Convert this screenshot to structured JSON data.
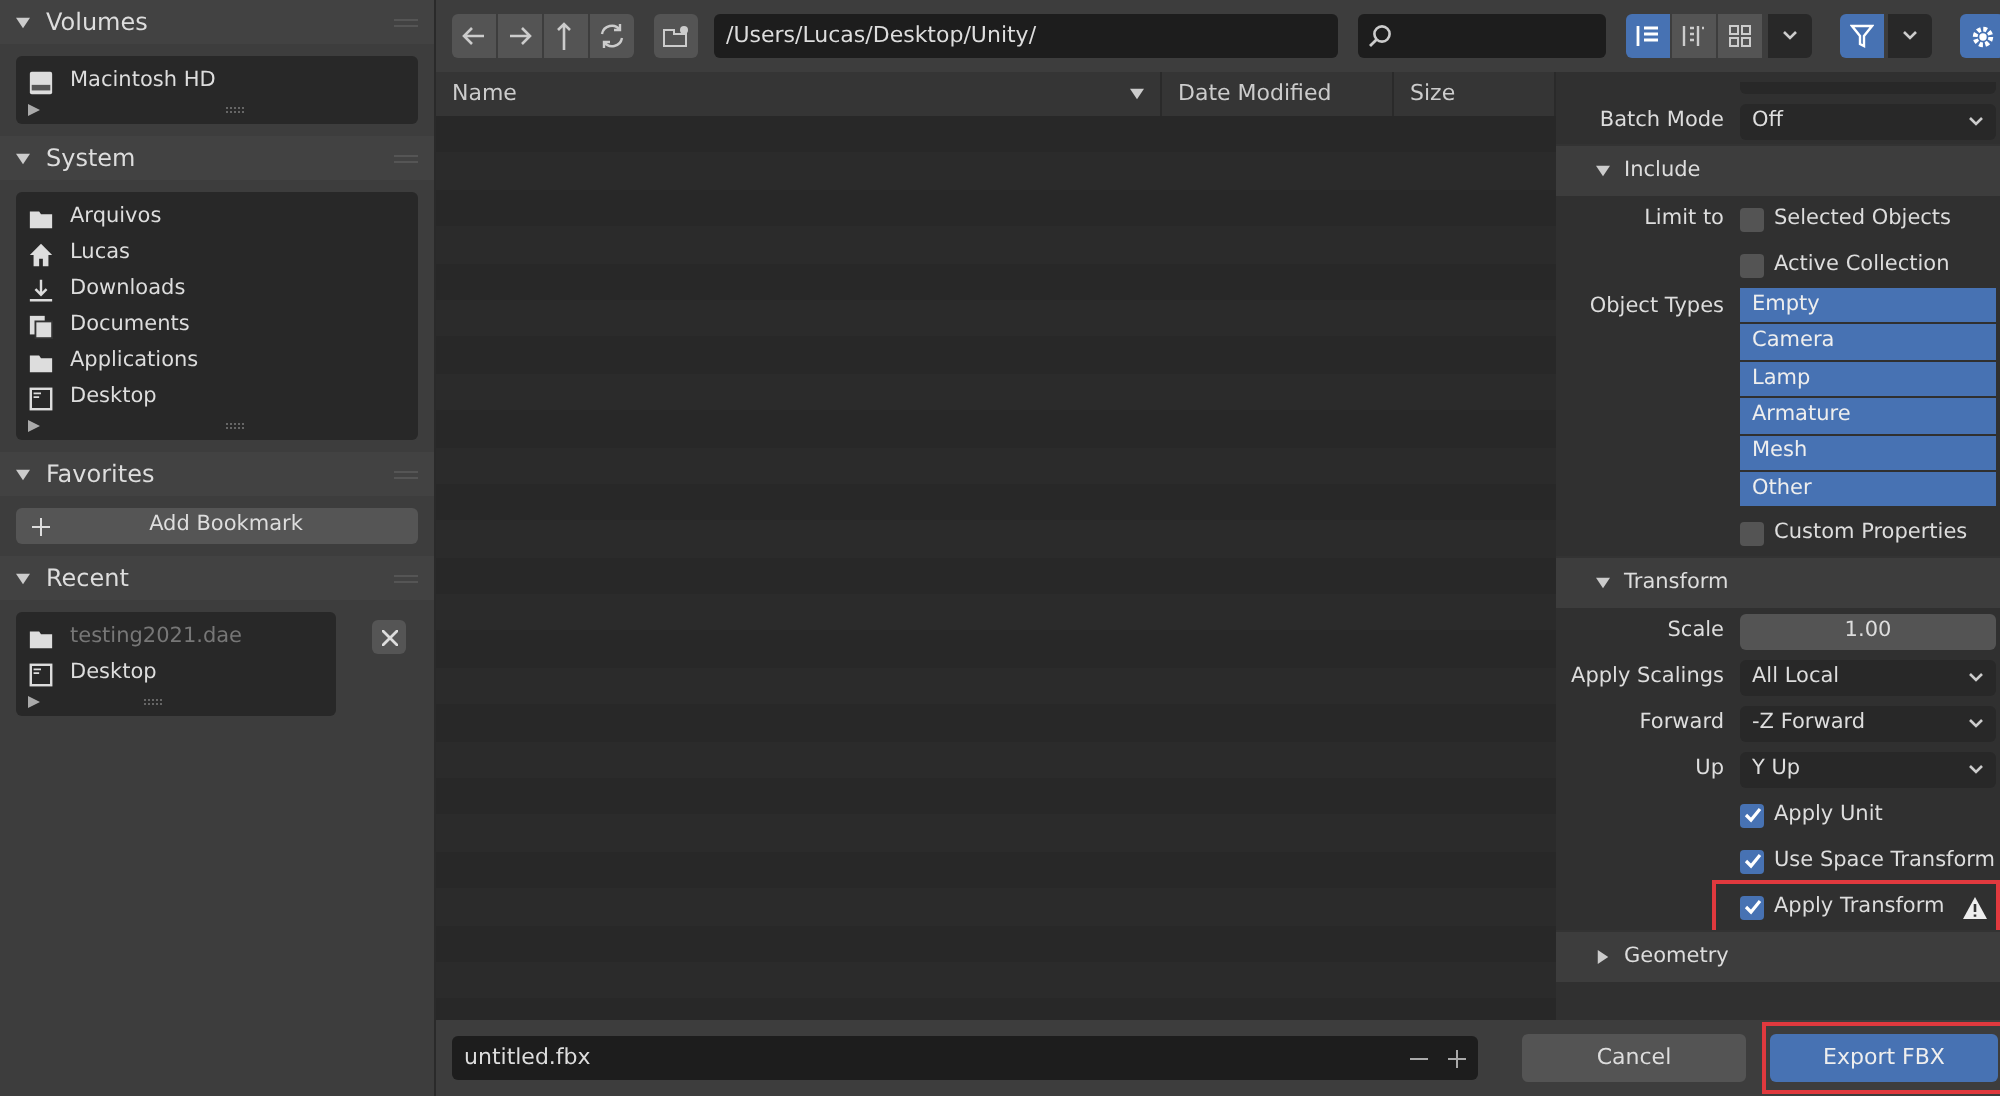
{
  "sidebar": [
    {
      "title": "Volumes",
      "expanded": true,
      "items": [
        {
          "kind": "drive",
          "label": "Macintosh HD",
          "dimmed": false
        }
      ]
    },
    {
      "title": "System",
      "expanded": true,
      "items": [
        {
          "kind": "folder",
          "label": "Arquivos",
          "dimmed": false
        },
        {
          "kind": "home",
          "label": "Lucas",
          "dimmed": false
        },
        {
          "kind": "download",
          "label": "Downloads",
          "dimmed": false
        },
        {
          "kind": "documents",
          "label": "Documents",
          "dimmed": false
        },
        {
          "kind": "folder",
          "label": "Applications",
          "dimmed": false
        },
        {
          "kind": "desktop",
          "label": "Desktop",
          "dimmed": false
        }
      ]
    },
    {
      "title": "Favorites",
      "expanded": true,
      "button": "Add Bookmark"
    },
    {
      "title": "Recent",
      "expanded": true,
      "removable": true,
      "items": [
        {
          "kind": "folder",
          "label": "testing2021.dae",
          "dimmed": true
        },
        {
          "kind": "desktop",
          "label": "Desktop",
          "dimmed": false
        }
      ]
    }
  ],
  "toolbar": {
    "path": "/Users/Lucas/Desktop/Unity/",
    "view_modes": [
      {
        "kind": "list",
        "selected": true
      },
      {
        "kind": "columns",
        "selected": false
      },
      {
        "kind": "grid",
        "selected": false
      }
    ],
    "filter_on": true,
    "settings_on": true
  },
  "columns": [
    {
      "label": "Name",
      "sorted": true
    },
    {
      "label": "Date Modified",
      "sorted": false
    },
    {
      "label": "Size",
      "sorted": false
    }
  ],
  "settings": [
    {
      "kind": "dropdown",
      "label": "Batch Mode",
      "value": "Off"
    },
    {
      "kind": "section",
      "label": "Include",
      "expanded": true
    },
    {
      "kind": "checkbox",
      "label": "Limit to",
      "text": "Selected Objects",
      "checked": false
    },
    {
      "kind": "checkbox",
      "text": "Active Collection",
      "checked": false
    },
    {
      "kind": "toggles",
      "label": "Object Types",
      "options": [
        {
          "text": "Empty",
          "selected": true
        },
        {
          "text": "Camera",
          "selected": true
        },
        {
          "text": "Lamp",
          "selected": true
        },
        {
          "text": "Armature",
          "selected": true
        },
        {
          "text": "Mesh",
          "selected": true
        },
        {
          "text": "Other",
          "selected": true
        }
      ]
    },
    {
      "kind": "checkbox",
      "text": "Custom Properties",
      "checked": false
    },
    {
      "kind": "section",
      "label": "Transform",
      "expanded": true
    },
    {
      "kind": "number",
      "label": "Scale",
      "value": "1.00"
    },
    {
      "kind": "dropdown",
      "label": "Apply Scalings",
      "value": "All Local"
    },
    {
      "kind": "dropdown",
      "label": "Forward",
      "value": "-Z Forward"
    },
    {
      "kind": "dropdown",
      "label": "Up",
      "value": "Y Up"
    },
    {
      "kind": "checkbox",
      "text": "Apply Unit",
      "checked": true
    },
    {
      "kind": "checkbox",
      "text": "Use Space Transform",
      "checked": true
    },
    {
      "kind": "checkbox",
      "text": "Apply Transform",
      "checked": true,
      "highlighted": true,
      "warning": true
    },
    {
      "kind": "section",
      "label": "Geometry",
      "expanded": false
    }
  ],
  "footer": {
    "filename": "untitled.fbx",
    "cancel": "Cancel",
    "confirm": "Export FBX",
    "confirm_highlighted": true
  }
}
